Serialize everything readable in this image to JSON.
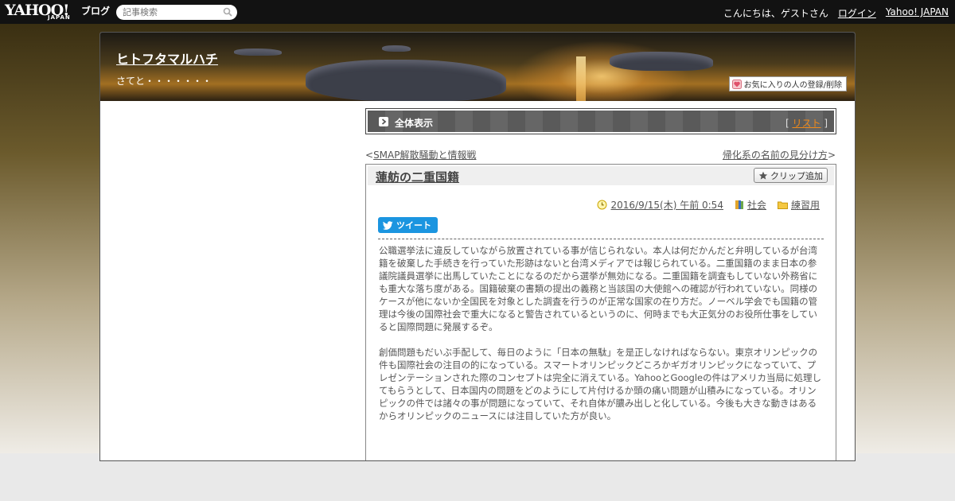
{
  "topbar": {
    "logo_main": "YAHOO!",
    "logo_sub": "JAPAN",
    "logo_blog": "ブログ",
    "search_placeholder": "記事検索",
    "greeting": "こんにちは、ゲストさん",
    "login": "ログイン",
    "yahoo_japan": "Yahoo! JAPAN"
  },
  "blog": {
    "title": "ヒトフタマルハチ",
    "subtitle": "さてと・・・・・・・",
    "favorite_button": "お気に入りの人の登録/削除"
  },
  "toolbar": {
    "label": "全体表示",
    "list_open": "[",
    "list_link": "リスト",
    "list_close": "]"
  },
  "nav": {
    "prev_prefix": "<",
    "prev_title": "SMAP解散騒動と情報戦",
    "next_title": "帰化系の名前の見分け方",
    "next_suffix": ">"
  },
  "article": {
    "title": "蓮舫の二重国籍",
    "clip_button": "クリップ追加",
    "date": "2016/9/15(木) 午前 0:54",
    "category": "社会",
    "folder": "練習用",
    "tweet_button": "ツイート",
    "paragraphs": [
      "公職選挙法に違反していながら放置されている事が信じられない。本人は何だかんだと弁明しているが台湾籍を破棄した手続きを行っていた形跡はないと台湾メディアでは報じられている。二重国籍のまま日本の参議院議員選挙に出馬していたことになるのだから選挙が無効になる。二重国籍を調査もしていない外務省にも重大な落ち度がある。国籍破棄の書類の提出の義務と当該国の大使館への確認が行われていない。同様のケースが他にないか全国民を対象とした調査を行うのが正常な国家の在り方だ。ノーベル学会でも国籍の管理は今後の国際社会で重大になると警告されているというのに、何時までも大正気分のお役所仕事をしていると国際問題に発展するぞ。",
      "創価問題もだいぶ手配して、毎日のように「日本の無駄」を是正しなければならない。東京オリンピックの件も国際社会の注目の的になっている。スマートオリンピックどころかギガオリンピックになっていて、プレゼンテーションされた際のコンセプトは完全に消えている。YahooとGoogleの件はアメリカ当局に処理してもらうとして、日本国内の問題をどのようにして片付けるか頭の痛い問題が山積みになっている。オリンピックの件では諸々の事が問題になっていて、それ自体が膿み出しと化している。今後も大きな動きはあるからオリンピックのニュースには注目していた方が良い。"
    ]
  },
  "colors": {
    "topbar": "#121212",
    "tweet": "#1b95e0",
    "list_link": "#f08a1a"
  }
}
